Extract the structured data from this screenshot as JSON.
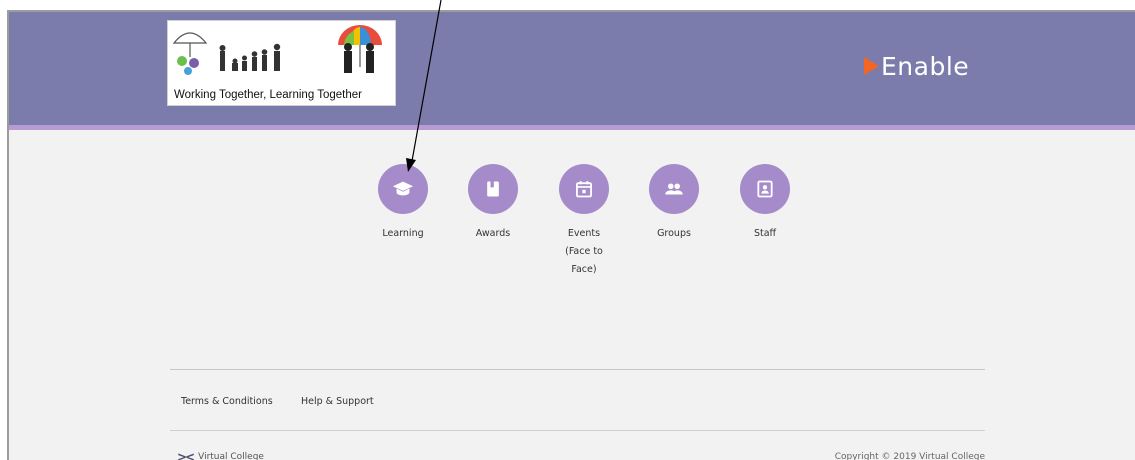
{
  "header": {
    "logo_caption": "Working Together, Learning Together",
    "brand_name": "Enable",
    "colors": {
      "header_bg": "#7c7cac",
      "stripe": "#b89bd2",
      "brand_arrow": "#f26522"
    }
  },
  "nav": {
    "items": [
      {
        "label": "Learning",
        "icon": "graduation-cap-icon"
      },
      {
        "label": "Awards",
        "icon": "book-icon"
      },
      {
        "label": "Events\n(Face to\nFace)",
        "icon": "calendar-icon"
      },
      {
        "label": "Groups",
        "icon": "people-icon"
      },
      {
        "label": "Staff",
        "icon": "id-badge-icon"
      }
    ],
    "color": "#a68bcb"
  },
  "footer": {
    "links": [
      "Terms & Conditions",
      "Help & Support"
    ],
    "company": "Virtual College",
    "copyright": "Copyright © 2019 Virtual College"
  }
}
